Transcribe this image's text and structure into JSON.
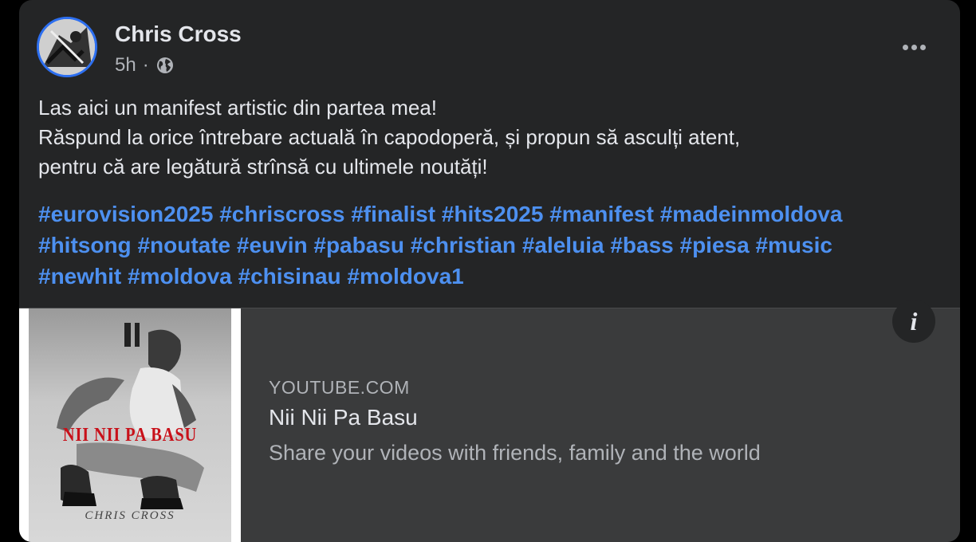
{
  "post": {
    "author": "Chris Cross",
    "time": "5h",
    "separator": "·",
    "privacy_icon": "globe-icon",
    "more_icon": "more-options-icon",
    "text_lines": [
      "Las aici un manifest artistic din partea mea!",
      "Răspund la orice întrebare actuală în capodoperă, și propun să asculți atent,",
      "pentru că are legătură strînsă cu ultimele noutăți!"
    ],
    "hashtag_lines": [
      "#eurovision2025 #chriscross #finalist #hits2025 #manifest #madeinmoldova",
      "#hitsong #noutate #euvin #pabasu #christian #aleluia #bass #piesa #music",
      "#newhit #moldova #chisinau #moldova1"
    ]
  },
  "link_preview": {
    "source": "YOUTUBE.COM",
    "title": "Nii Nii Pa Basu",
    "description": "Share your videos with friends, family and the world",
    "thumbnail_title": "NII NII PA BASU",
    "thumbnail_artist": "CHRIS CROSS",
    "info_icon": "info-icon"
  },
  "colors": {
    "card_bg": "#242526",
    "preview_bg": "#3a3b3c",
    "hashtag": "#4d90f0",
    "text_primary": "#e4e6eb",
    "text_secondary": "#b0b3b8",
    "avatar_ring": "#2d6ff0"
  }
}
